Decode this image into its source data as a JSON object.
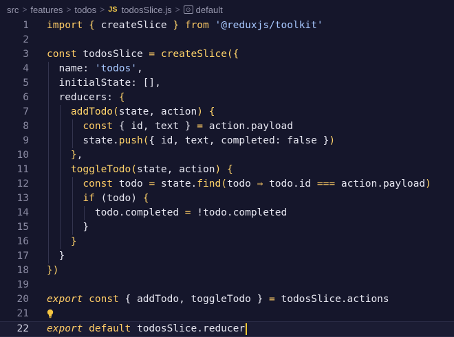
{
  "breadcrumb": {
    "items": [
      "src",
      "features",
      "todos"
    ],
    "file_badge": "JS",
    "file_name": "todosSlice.js",
    "symbol_icon": "[⊙]",
    "symbol": "default",
    "separator": ">"
  },
  "colors": {
    "background": "#15162b",
    "keyword": "#ffcc66",
    "string": "#a8c8ff",
    "text": "#e6e6f0",
    "line_number": "#8a8aa2",
    "cursor": "#ffcc33"
  },
  "editor": {
    "line_numbers": [
      "1",
      "2",
      "3",
      "4",
      "5",
      "6",
      "7",
      "8",
      "9",
      "10",
      "11",
      "12",
      "13",
      "14",
      "15",
      "16",
      "17",
      "18",
      "19",
      "20",
      "21",
      "22"
    ],
    "current_line": "22",
    "lightbulb_line": "21",
    "lines": [
      [
        [
          "kw",
          "import"
        ],
        [
          "id",
          " "
        ],
        [
          "br",
          "{"
        ],
        [
          "id",
          " createSlice "
        ],
        [
          "br",
          "}"
        ],
        [
          "id",
          " "
        ],
        [
          "kw",
          "from"
        ],
        [
          "id",
          " "
        ],
        [
          "str",
          "'@reduxjs/toolkit'"
        ]
      ],
      [],
      [
        [
          "kw",
          "const"
        ],
        [
          "id",
          " todosSlice "
        ],
        [
          "op",
          "="
        ],
        [
          "id",
          " "
        ],
        [
          "fn",
          "createSlice"
        ],
        [
          "br",
          "({"
        ]
      ],
      [
        [
          "id",
          "  name: "
        ],
        [
          "str",
          "'todos'"
        ],
        [
          "id",
          ","
        ]
      ],
      [
        [
          "id",
          "  initialState: [],"
        ]
      ],
      [
        [
          "id",
          "  reducers: "
        ],
        [
          "br",
          "{"
        ]
      ],
      [
        [
          "id",
          "    "
        ],
        [
          "fn",
          "addTodo"
        ],
        [
          "br",
          "("
        ],
        [
          "id",
          "state, action"
        ],
        [
          "br",
          ")"
        ],
        [
          "id",
          " "
        ],
        [
          "br",
          "{"
        ]
      ],
      [
        [
          "id",
          "      "
        ],
        [
          "kw",
          "const"
        ],
        [
          "id",
          " { id, text } "
        ],
        [
          "op",
          "="
        ],
        [
          "id",
          " action.payload"
        ]
      ],
      [
        [
          "id",
          "      state."
        ],
        [
          "fn",
          "push"
        ],
        [
          "br",
          "("
        ],
        [
          "id",
          "{ id, text, completed: "
        ],
        [
          "bool",
          "false"
        ],
        [
          "id",
          " }"
        ],
        [
          "br",
          ")"
        ]
      ],
      [
        [
          "id",
          "    "
        ],
        [
          "br",
          "}"
        ],
        [
          "id",
          ","
        ]
      ],
      [
        [
          "id",
          "    "
        ],
        [
          "fn",
          "toggleTodo"
        ],
        [
          "br",
          "("
        ],
        [
          "id",
          "state, action"
        ],
        [
          "br",
          ")"
        ],
        [
          "id",
          " "
        ],
        [
          "br",
          "{"
        ]
      ],
      [
        [
          "id",
          "      "
        ],
        [
          "kw",
          "const"
        ],
        [
          "id",
          " todo "
        ],
        [
          "op",
          "="
        ],
        [
          "id",
          " state."
        ],
        [
          "fn",
          "find"
        ],
        [
          "br",
          "("
        ],
        [
          "id",
          "todo "
        ],
        [
          "op",
          "⇒"
        ],
        [
          "id",
          " todo.id "
        ],
        [
          "op",
          "==="
        ],
        [
          "id",
          " action.payload"
        ],
        [
          "br",
          ")"
        ]
      ],
      [
        [
          "id",
          "      "
        ],
        [
          "kw",
          "if"
        ],
        [
          "id",
          " (todo) "
        ],
        [
          "br",
          "{"
        ]
      ],
      [
        [
          "id",
          "        todo.completed "
        ],
        [
          "op",
          "="
        ],
        [
          "id",
          " !todo.completed"
        ]
      ],
      [
        [
          "id",
          "      }"
        ]
      ],
      [
        [
          "id",
          "    "
        ],
        [
          "br",
          "}"
        ]
      ],
      [
        [
          "id",
          "  }"
        ]
      ],
      [
        [
          "br",
          "})"
        ]
      ],
      [],
      [
        [
          "kw-i",
          "export"
        ],
        [
          "id",
          " "
        ],
        [
          "kw",
          "const"
        ],
        [
          "id",
          " { addTodo, toggleTodo } "
        ],
        [
          "op",
          "="
        ],
        [
          "id",
          " todosSlice.actions"
        ]
      ],
      [],
      [
        [
          "kw-i",
          "export"
        ],
        [
          "id",
          " "
        ],
        [
          "kw",
          "default"
        ],
        [
          "id",
          " todosSlice.reducer"
        ]
      ]
    ]
  }
}
